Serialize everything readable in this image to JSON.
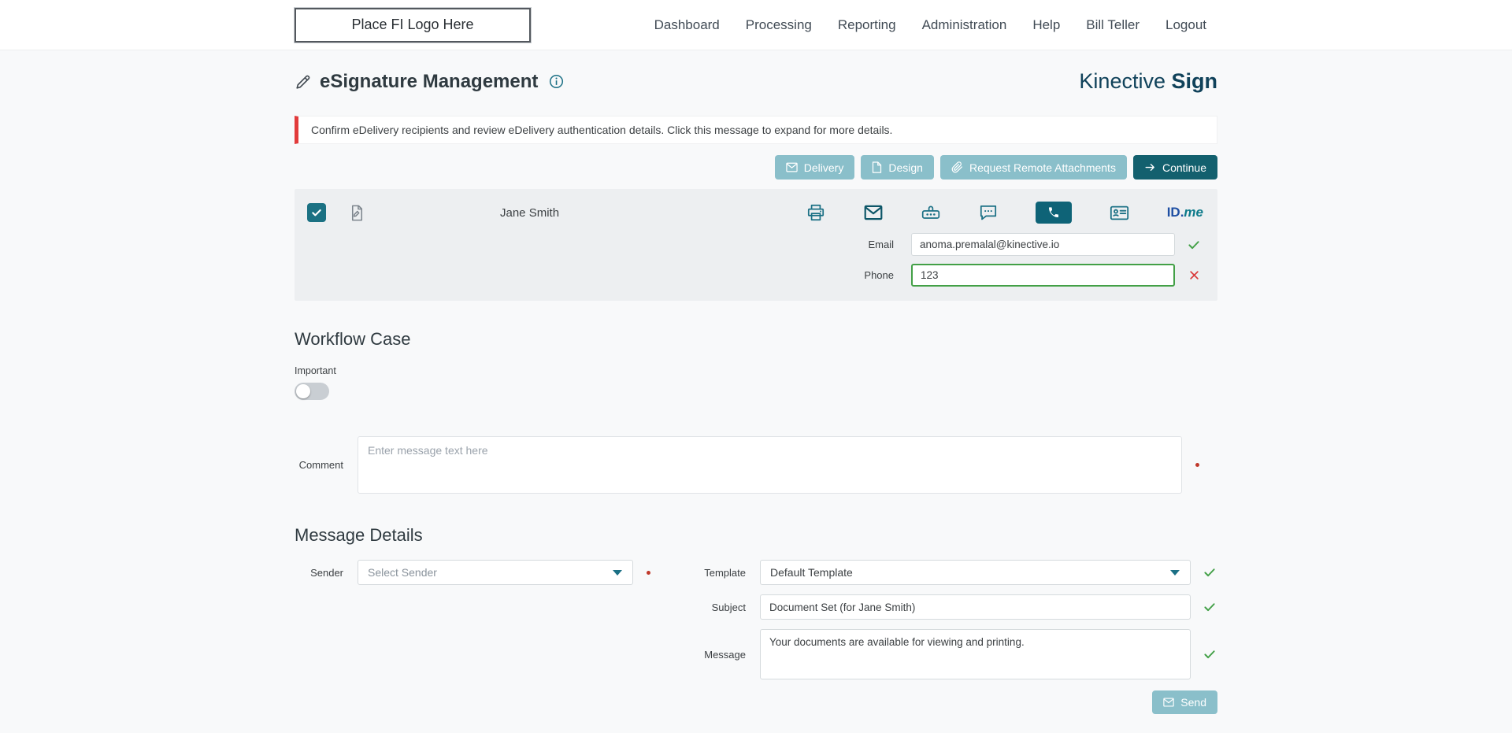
{
  "header": {
    "logo_text": "Place FI Logo Here",
    "nav": [
      "Dashboard",
      "Processing",
      "Reporting",
      "Administration",
      "Help",
      "Bill Teller",
      "Logout"
    ]
  },
  "page": {
    "title": "eSignature Management",
    "brand_name": "Kinective",
    "brand_product": "Sign",
    "alert": "Confirm eDelivery recipients and review eDelivery authentication details. Click this message to expand for more details."
  },
  "toolbar": {
    "delivery_label": "Delivery",
    "design_label": "Design",
    "request_label": "Request Remote Attachments",
    "continue_label": "Continue"
  },
  "recipient": {
    "name": "Jane Smith",
    "email_label": "Email",
    "email_value": "anoma.premalal@kinective.io",
    "phone_label": "Phone",
    "phone_value": "123",
    "idme_id": "ID.",
    "idme_me": "me",
    "method_icons": [
      "print",
      "email",
      "password",
      "sms",
      "phone",
      "id-card",
      "id-me"
    ],
    "active_method": "phone"
  },
  "workflow": {
    "heading": "Workflow Case",
    "important_label": "Important",
    "important_on": false,
    "comment_label": "Comment",
    "comment_placeholder": "Enter message text here"
  },
  "message_details": {
    "heading": "Message Details",
    "sender_label": "Sender",
    "sender_value": "Select Sender",
    "template_label": "Template",
    "template_value": "Default Template",
    "subject_label": "Subject",
    "subject_value": "Document Set (for Jane Smith)",
    "message_label": "Message",
    "message_value": "Your documents are available for viewing and printing.",
    "send_label": "Send"
  },
  "colors": {
    "primary_teal": "#13606e",
    "light_teal": "#8abfca",
    "icon_teal": "#1b7085",
    "active_method_bg": "#0e6377",
    "brand_navy": "#10425a",
    "alert_red": "#e23b3b",
    "success_green": "#43a047",
    "error_red": "#d93838"
  }
}
